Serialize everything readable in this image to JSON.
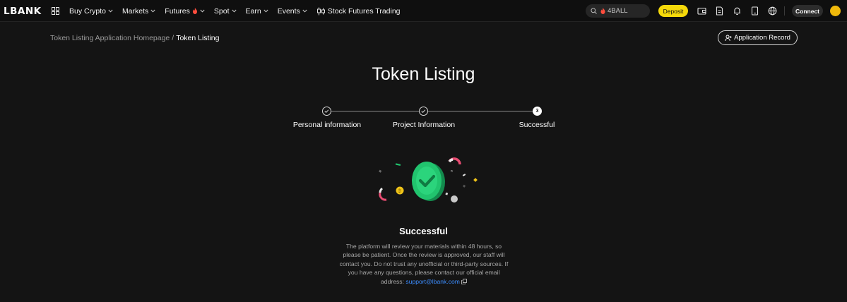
{
  "brand": {
    "logo": "LBANK",
    "accent": "#f5d90a",
    "link_color": "#3c8dff"
  },
  "nav": {
    "items": [
      {
        "label": "Buy Crypto",
        "chevron": true,
        "flame": false
      },
      {
        "label": "Markets",
        "chevron": true,
        "flame": false
      },
      {
        "label": "Futures",
        "chevron": true,
        "flame": true
      },
      {
        "label": "Spot",
        "chevron": true,
        "flame": false
      },
      {
        "label": "Earn",
        "chevron": true,
        "flame": false
      },
      {
        "label": "Events",
        "chevron": true,
        "flame": false
      },
      {
        "label": "Stock Futures Trading",
        "chevron": false,
        "flame": false
      }
    ],
    "search_value": "4BALL",
    "deposit_label": "Deposit",
    "connect_label": "Connect",
    "icons": [
      "wallet-icon",
      "document-icon",
      "bell-icon",
      "download-icon",
      "globe-icon"
    ]
  },
  "breadcrumb": {
    "parent": "Token Listing Application Homepage",
    "separator": "/",
    "current": "Token Listing"
  },
  "record_button": "Application Record",
  "page": {
    "title": "Token Listing",
    "steps": [
      {
        "label": "Personal information",
        "state": "done"
      },
      {
        "label": "Project Information",
        "state": "done"
      },
      {
        "label": "Successful",
        "state": "current",
        "number": "3"
      }
    ]
  },
  "success": {
    "title": "Successful",
    "message": "The platform will review your materials within 48 hours, so please be patient. Once the review is approved, our staff will contact you. Do not trust any unofficial or third-party sources. If you have any questions, please contact our official email address: ",
    "email": "support@lbank.com"
  }
}
